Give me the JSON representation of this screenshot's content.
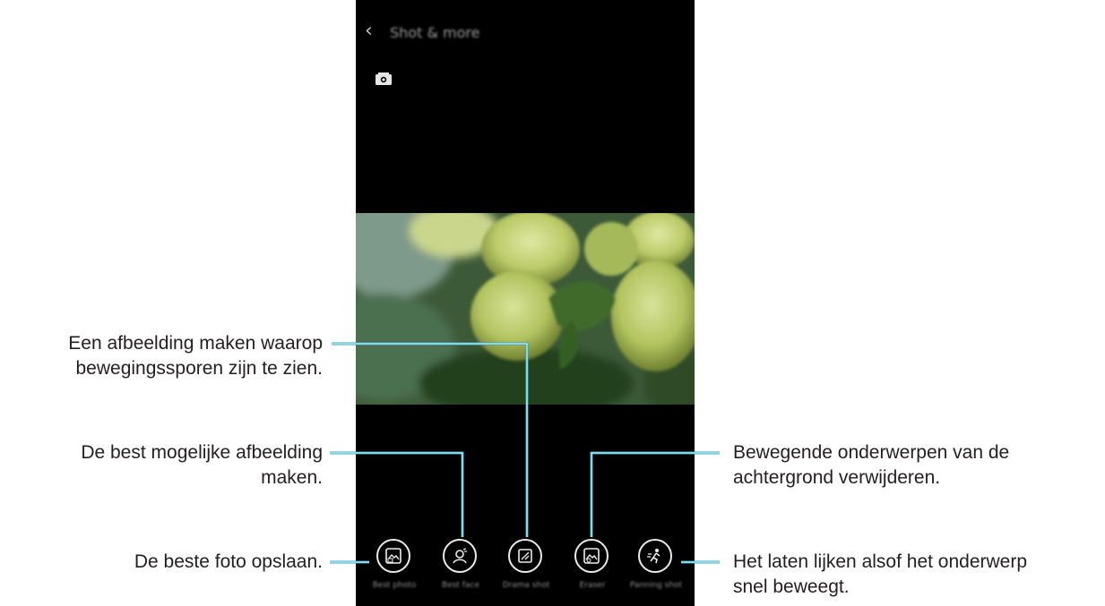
{
  "screen": {
    "back_glyph": "‹",
    "title": "Shot & more"
  },
  "modes": [
    {
      "label": "Best photo",
      "icon": "best-photo-icon"
    },
    {
      "label": "Best face",
      "icon": "best-face-icon"
    },
    {
      "label": "Drama shot",
      "icon": "drama-shot-icon"
    },
    {
      "label": "Eraser",
      "icon": "eraser-icon"
    },
    {
      "label": "Panning shot",
      "icon": "panning-shot-icon"
    }
  ],
  "callouts": {
    "drama": "Een afbeelding maken waarop\nbewegingssporen zijn te zien.",
    "best_face": "De best mogelijke afbeelding\nmaken.",
    "best_photo": "De beste foto opslaan.",
    "eraser": "Bewegende onderwerpen van de\nachtergrond verwijderen.",
    "panning": "Het laten lijken alsof het onderwerp\nsnel beweegt."
  },
  "colors": {
    "line": "#2aa7c6",
    "screen_bg": "#000000",
    "text": "#231f20"
  }
}
